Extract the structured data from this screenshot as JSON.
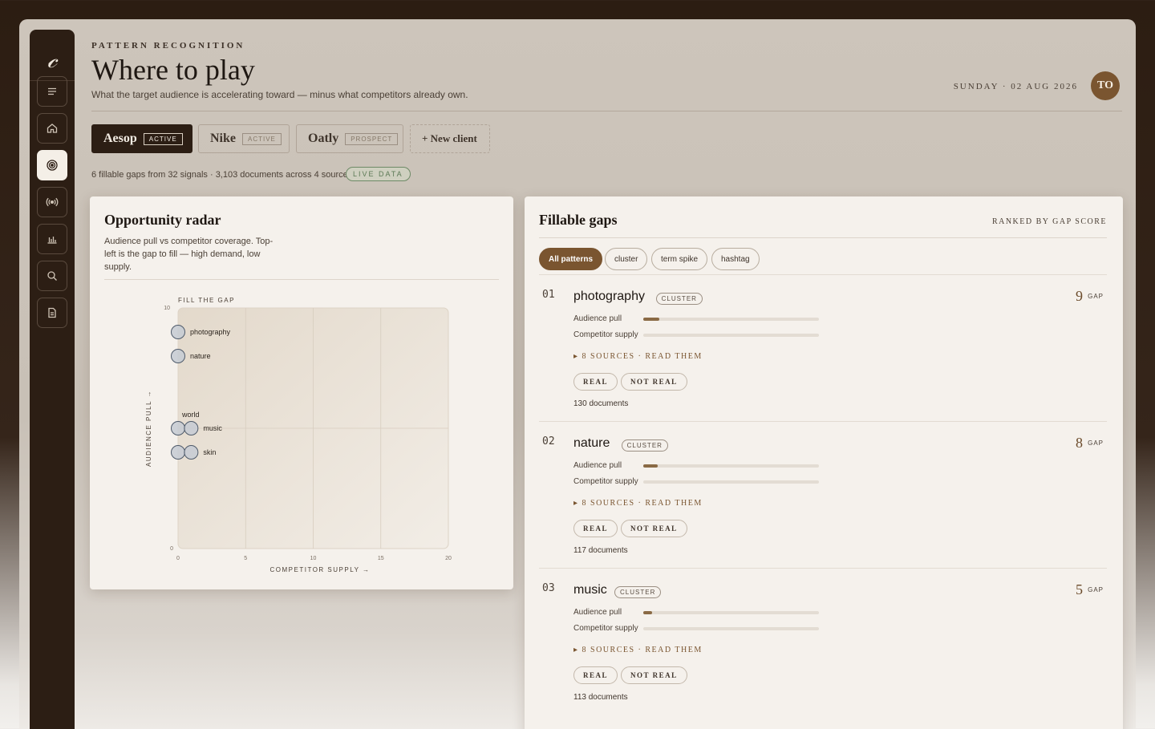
{
  "sidebar": {
    "logo": "𝒸",
    "items": [
      {
        "name": "menu-icon"
      },
      {
        "name": "home-icon"
      },
      {
        "name": "target-icon",
        "active": true
      },
      {
        "name": "broadcast-icon"
      },
      {
        "name": "bar-chart-icon"
      },
      {
        "name": "search-icon"
      },
      {
        "name": "document-icon"
      }
    ]
  },
  "header": {
    "eyebrow": "PATTERN RECOGNITION",
    "title": "Where to play",
    "subtitle": "What the target audience is accelerating toward — minus what competitors already own.",
    "date": "SUNDAY · 02 AUG 2026",
    "avatar": "TO"
  },
  "clients": [
    {
      "name": "Aesop",
      "tag": "ACTIVE",
      "active": true
    },
    {
      "name": "Nike",
      "tag": "ACTIVE"
    },
    {
      "name": "Oatly",
      "tag": "PROSPECT"
    }
  ],
  "new_client": "+ New client",
  "stats": "6 fillable gaps from 32 signals · 3,103 documents across 4 sources",
  "live": "LIVE DATA",
  "radar": {
    "title": "Opportunity radar",
    "description": "Audience pull vs competitor coverage. Top-left is the gap to fill — high demand, low supply."
  },
  "chart_data": {
    "type": "scatter",
    "title": "FILL THE GAP",
    "xlabel": "COMPETITOR SUPPLY →",
    "ylabel": "AUDIENCE PULL →",
    "xlim": [
      0,
      20
    ],
    "ylim": [
      0,
      10
    ],
    "x_ticks": [
      "0",
      "5",
      "10",
      "15",
      "20"
    ],
    "y_ticks": [
      "0",
      "10"
    ],
    "grid": true,
    "points": [
      {
        "label": "photography",
        "x": 0,
        "y": 9
      },
      {
        "label": "nature",
        "x": 0,
        "y": 8
      },
      {
        "label": "world",
        "x": 0,
        "y": 5
      },
      {
        "label": "music",
        "x": 1,
        "y": 5
      },
      {
        "label": "",
        "x": 0,
        "y": 4
      },
      {
        "label": "skin",
        "x": 1,
        "y": 4
      }
    ]
  },
  "gaps": {
    "title": "Fillable gaps",
    "caption": "RANKED BY GAP SCORE",
    "filters": [
      "All patterns",
      "cluster",
      "term spike",
      "hashtag"
    ],
    "audience_label": "Audience pull",
    "supply_label": "Competitor supply",
    "gap_label": "GAP",
    "real_label": "REAL",
    "not_real_label": "NOT REAL",
    "rows": [
      {
        "num": "01",
        "name": "photography",
        "kind": "CLUSTER",
        "score": "9",
        "audience": 0.09,
        "supply": 0.0,
        "sources": "▸ 8 SOURCES · READ THEM",
        "docs": "130 documents"
      },
      {
        "num": "02",
        "name": "nature",
        "kind": "CLUSTER",
        "score": "8",
        "audience": 0.08,
        "supply": 0.0,
        "sources": "▸ 8 SOURCES · READ THEM",
        "docs": "117 documents"
      },
      {
        "num": "03",
        "name": "music",
        "kind": "CLUSTER",
        "score": "5",
        "audience": 0.05,
        "supply": 0.0,
        "sources": "▸ 8 SOURCES · READ THEM",
        "docs": "113 documents"
      }
    ]
  }
}
